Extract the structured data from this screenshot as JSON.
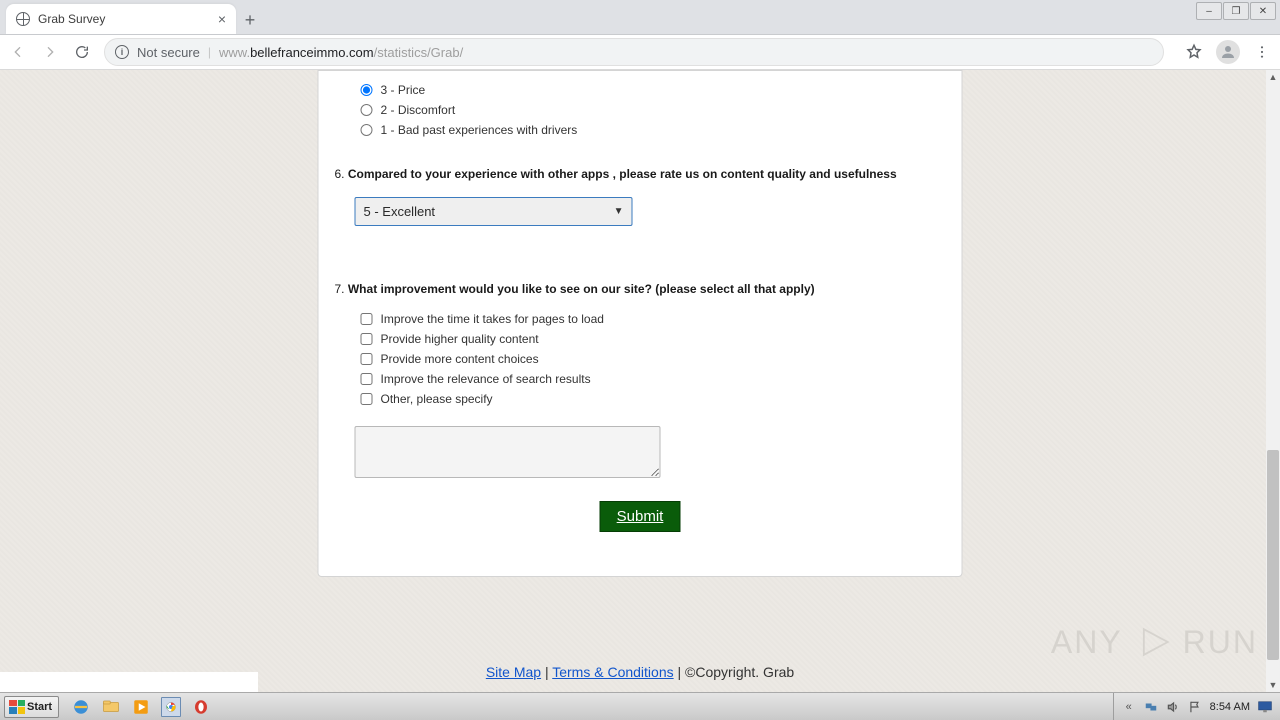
{
  "browser": {
    "tab_title": "Grab Survey",
    "not_secure": "Not secure",
    "url_prefix": "www.",
    "url_domain": "bellefranceimmo.com",
    "url_path": "/statistics/Grab/"
  },
  "survey": {
    "q5_options": [
      {
        "label": "3 - Price",
        "checked": true
      },
      {
        "label": "2 - Discomfort",
        "checked": false
      },
      {
        "label": "1 - Bad past experiences with drivers",
        "checked": false
      }
    ],
    "q6": {
      "num": "6.",
      "text": "Compared to your experience with other apps , please rate us on content quality and usefulness",
      "selected": "5 - Excellent"
    },
    "q7": {
      "num": "7.",
      "text": "What improvement would you like to see on our site? (please select all that apply)",
      "options": [
        "Improve the time it takes for pages to load",
        "Provide higher quality content",
        "Provide more content choices",
        "Improve the relevance of search results",
        "Other, please specify"
      ]
    },
    "submit": "Submit"
  },
  "footer": {
    "sitemap": "Site Map",
    "terms": "Terms & Conditions",
    "copyright": "©Copyright. Grab"
  },
  "watermark": {
    "left": "ANY",
    "right": "RUN"
  },
  "taskbar": {
    "start": "Start",
    "clock": "8:54 AM"
  }
}
